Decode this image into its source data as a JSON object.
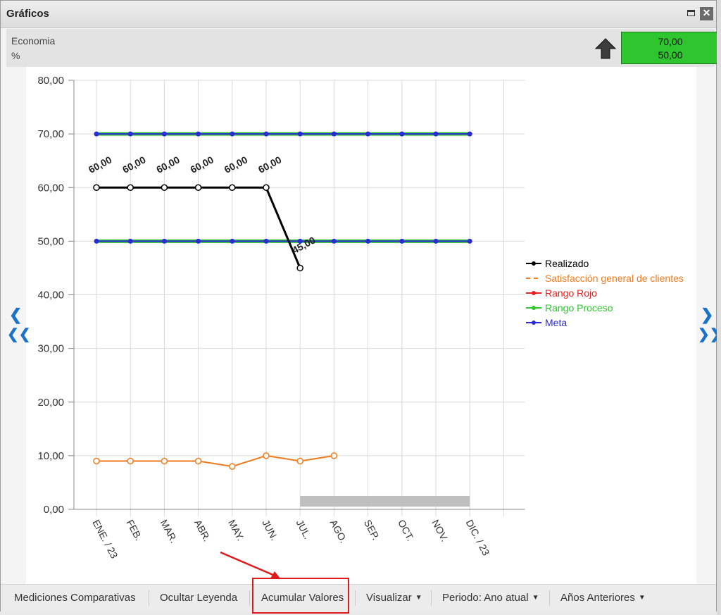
{
  "window": {
    "title": "Gráficos"
  },
  "header": {
    "indicator_name": "Economia",
    "unit": "%",
    "meta_top": "70,00",
    "meta_bottom": "50,00",
    "meta_color": "#2ec52e"
  },
  "nav": {
    "prev": "‹",
    "first": "«",
    "next": "›",
    "last": "»"
  },
  "toolbar": {
    "items": [
      "Mediciones Comparativas",
      "Ocultar Leyenda",
      "Acumular Valores",
      "Visualizar",
      "Periodo: Ano atual",
      "Años Anteriores"
    ]
  },
  "chart_data": {
    "type": "line",
    "categories": [
      "ENE. / 23",
      "FEB.",
      "MAR.",
      "ABR.",
      "MAY.",
      "JUN.",
      "JUL.",
      "AGO.",
      "SEP.",
      "OCT.",
      "NOV.",
      "DIC. / 23"
    ],
    "ylim": [
      0,
      80
    ],
    "yticks": [
      "0,00",
      "10,00",
      "20,00",
      "30,00",
      "40,00",
      "50,00",
      "60,00",
      "70,00",
      "80,00"
    ],
    "grid": true,
    "legend_position": "right",
    "series": [
      {
        "name": "Realizado",
        "color": "#000000",
        "values": [
          60,
          60,
          60,
          60,
          60,
          60,
          45
        ],
        "labels": [
          "60,00",
          "60,00",
          "60,00",
          "60,00",
          "60,00",
          "60,00",
          "45,00"
        ]
      },
      {
        "name": "Satisfacción general de clientes",
        "color": "#f07a1e",
        "values": [
          9,
          9,
          9,
          9,
          8,
          10,
          9,
          10
        ]
      },
      {
        "name": "Rango Rojo",
        "color": "#e8201f",
        "values": []
      },
      {
        "name": "Rango Proceso",
        "color": "#2ec52e",
        "values": [
          70,
          70,
          70,
          70,
          70,
          70,
          70,
          70,
          70,
          70,
          70,
          70
        ]
      },
      {
        "name": "Meta",
        "color": "#2b2bd6",
        "values": [
          70,
          70,
          70,
          70,
          70,
          70,
          70,
          70,
          70,
          70,
          70,
          70
        ]
      },
      {
        "name": "Meta",
        "color": "#2b2bd6",
        "values": [
          50,
          50,
          50,
          50,
          50,
          50,
          50,
          50,
          50,
          50,
          50,
          50
        ]
      },
      {
        "name": "Rango Proceso",
        "color": "#2ec52e",
        "values": [
          50,
          50,
          50,
          50,
          50,
          50,
          50,
          50,
          50,
          50,
          50,
          50
        ]
      }
    ],
    "bar_range": {
      "from_index": 6,
      "to_index": 11,
      "low": 0.5,
      "high": 2.5,
      "color": "#bfbfbf"
    }
  }
}
